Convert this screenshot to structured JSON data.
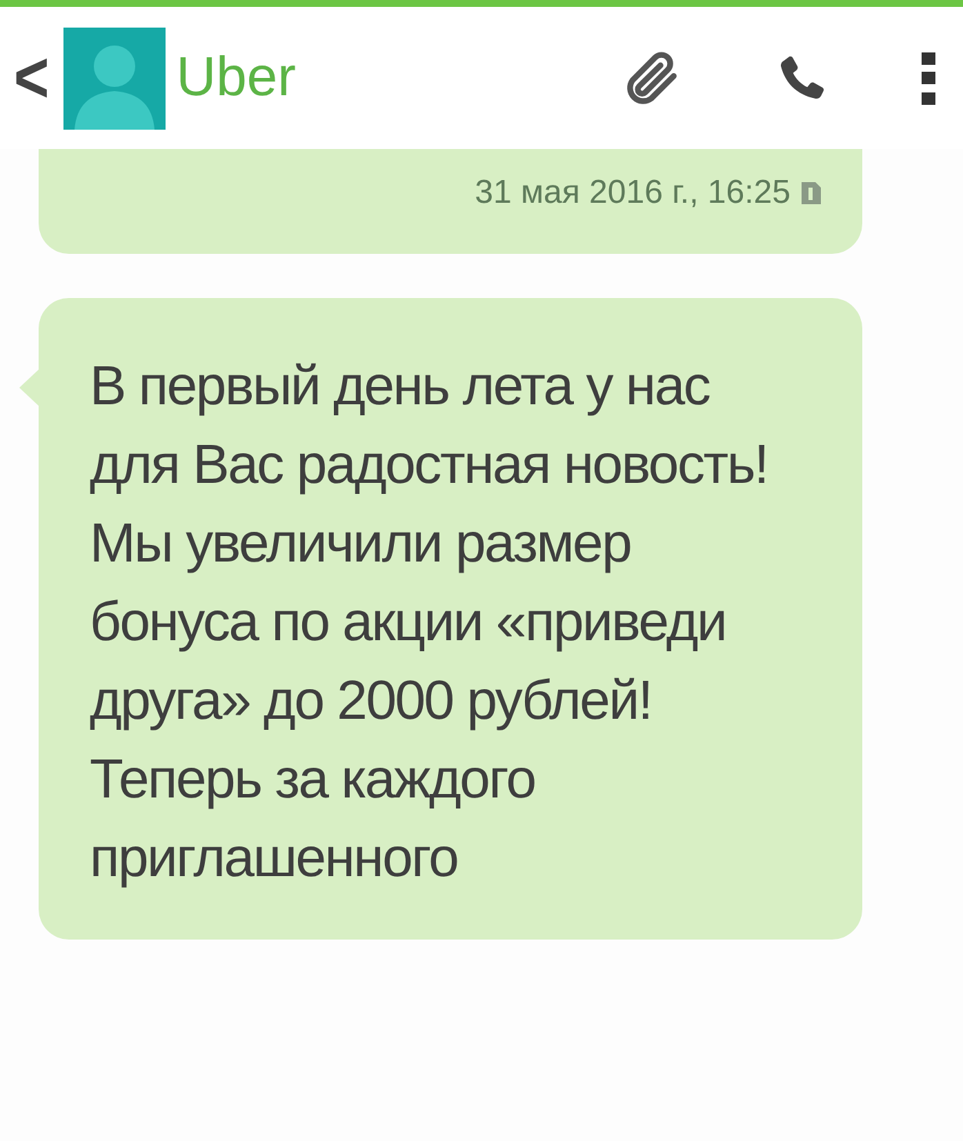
{
  "header": {
    "back": "<",
    "contact": "Uber"
  },
  "messages": [
    {
      "kind": "continued",
      "time": "31 мая 2016 г., 16:25"
    },
    {
      "kind": "full",
      "text": "В первый день лета у нас для Вас радостная новость!\nМы увеличили размер бонуса по акции «приведи друга» до 2000 рублей! Теперь за каждого приглашенного"
    }
  ]
}
